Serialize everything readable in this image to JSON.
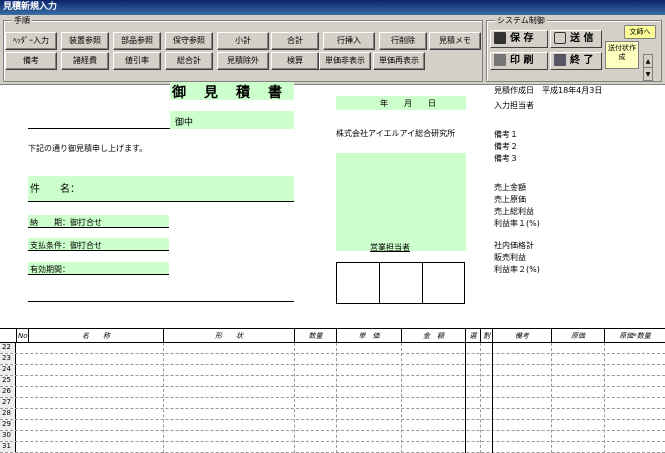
{
  "window": {
    "title": "見積新規入力"
  },
  "toolbar": {
    "group_procedure": "手順",
    "group_system": "システム制御",
    "row1": [
      "ﾍｯﾀﾞｰ入力",
      "装置参照",
      "部品参照",
      "保守参照",
      "小計",
      "合計",
      "行挿入",
      "行削除",
      "見積メモ"
    ],
    "row2": [
      "備考",
      "諸経費",
      "値引率",
      "総合計",
      "見積除外",
      "検算",
      "単価非表示",
      "単価再表示"
    ],
    "save": "保 存",
    "send": "送 信",
    "print": "印 刷",
    "exit": "終 了",
    "doc_to": "文師へ",
    "send_status": "送付状作成"
  },
  "doc": {
    "title": "御　見　積　書",
    "onchu": "御中",
    "intro": "下記の通り御見積申し上げます。",
    "kenmei": "件　　名：",
    "nouki": "納　　期：御打合せ",
    "shiharai": "支払条件：御打合せ",
    "yuko": "有効期間：",
    "date_line": "年　　月　　日",
    "company": "株式会社アイエルアイ総合研究所",
    "sales": "営業担当者",
    "right": [
      "見積作成日　平成18年4月3日",
      "入力担当者",
      "備考１",
      "備考２",
      "備考３",
      "売上金額",
      "売上原価",
      "売上総利益",
      "利益率１(%)",
      "社内価格計",
      "販売利益",
      "利益率２(%)"
    ]
  },
  "table": {
    "headers": [
      "No",
      "名　　称",
      "形　　状",
      "数量",
      "単　価",
      "金　額",
      "選",
      "割",
      "備考",
      "原価",
      "原価*数量"
    ],
    "rows": [
      "22",
      "23",
      "24",
      "25",
      "26",
      "27",
      "28",
      "29",
      "30",
      "31"
    ]
  }
}
